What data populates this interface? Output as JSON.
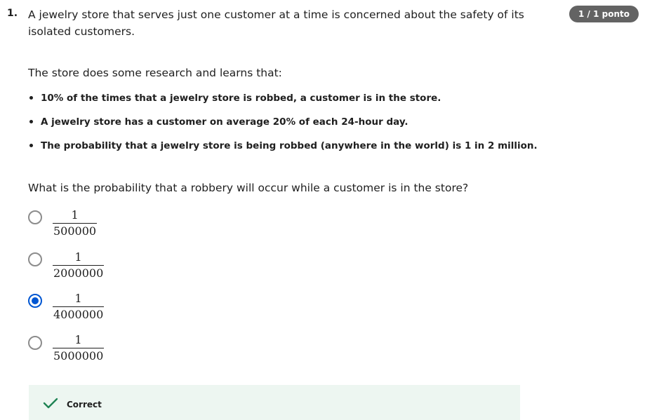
{
  "question": {
    "number": "1.",
    "score_badge": "1 / 1 ponto",
    "intro": "A jewelry store that serves just one customer at a time is concerned about the safety of its isolated customers.",
    "lead": "The store does some research and learns that:",
    "facts": [
      "10% of the times that a jewelry store is robbed, a customer is in the store.",
      "A jewelry store has a customer on average 20% of each 24-hour day.",
      "The probability that a jewelry store is being robbed (anywhere in the world) is 1 in 2 million."
    ],
    "prompt": "What is the probability that a robbery will occur while a customer is in the store?"
  },
  "options": [
    {
      "numerator": "1",
      "denominator": "500000",
      "selected": false
    },
    {
      "numerator": "1",
      "denominator": "2000000",
      "selected": false
    },
    {
      "numerator": "1",
      "denominator": "4000000",
      "selected": true
    },
    {
      "numerator": "1",
      "denominator": "5000000",
      "selected": false
    }
  ],
  "feedback": {
    "label": "Correct",
    "icon": "checkmark-icon"
  },
  "colors": {
    "accent": "#0056d2",
    "success": "#1f8354",
    "feedback_bg": "#edf6f1",
    "badge_bg": "#636363"
  }
}
